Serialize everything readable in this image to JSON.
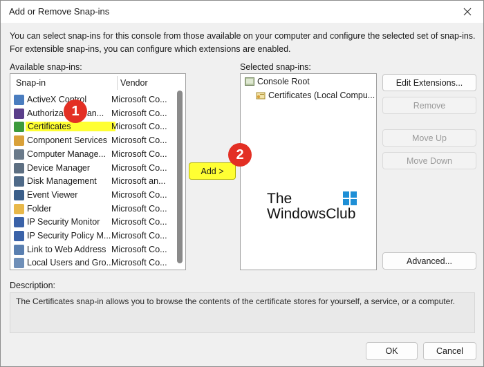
{
  "window": {
    "title": "Add or Remove Snap-ins"
  },
  "intro": {
    "line1": "You can select snap-ins for this console from those available on your computer and configure the selected set of snap-ins.",
    "line2": "For extensible snap-ins, you can configure which extensions are enabled."
  },
  "available": {
    "label": "Available snap-ins:",
    "col_snapin": "Snap-in",
    "col_vendor": "Vendor",
    "items": [
      {
        "name": "ActiveX Control",
        "vendor": "Microsoft Co...",
        "icon": "activex-icon",
        "color": "#4a7dbf"
      },
      {
        "name": "Authorization Man...",
        "vendor": "Microsoft Co...",
        "icon": "authorization-icon",
        "color": "#5a3e8a"
      },
      {
        "name": "Certificates",
        "vendor": "Microsoft Co...",
        "icon": "certificate-icon",
        "color": "#3c9a3c"
      },
      {
        "name": "Component Services",
        "vendor": "Microsoft Co...",
        "icon": "component-services-icon",
        "color": "#d9a13a"
      },
      {
        "name": "Computer Manage...",
        "vendor": "Microsoft Co...",
        "icon": "computer-management-icon",
        "color": "#6a7a8a"
      },
      {
        "name": "Device Manager",
        "vendor": "Microsoft Co...",
        "icon": "device-manager-icon",
        "color": "#5d6f82"
      },
      {
        "name": "Disk Management",
        "vendor": "Microsoft an...",
        "icon": "disk-management-icon",
        "color": "#4f6a88"
      },
      {
        "name": "Event Viewer",
        "vendor": "Microsoft Co...",
        "icon": "event-viewer-icon",
        "color": "#3b5f8a"
      },
      {
        "name": "Folder",
        "vendor": "Microsoft Co...",
        "icon": "folder-icon",
        "color": "#e8b84a"
      },
      {
        "name": "IP Security Monitor",
        "vendor": "Microsoft Co...",
        "icon": "ip-security-monitor-icon",
        "color": "#3a62a8"
      },
      {
        "name": "IP Security Policy M...",
        "vendor": "Microsoft Co...",
        "icon": "ip-security-policy-icon",
        "color": "#3a62a8"
      },
      {
        "name": "Link to Web Address",
        "vendor": "Microsoft Co...",
        "icon": "web-link-icon",
        "color": "#5a7fb0"
      },
      {
        "name": "Local Users and Gro...",
        "vendor": "Microsoft Co...",
        "icon": "local-users-icon",
        "color": "#6f8fb8"
      }
    ]
  },
  "actions": {
    "add": "Add >"
  },
  "selected": {
    "label": "Selected snap-ins:",
    "root": "Console Root",
    "child": "Certificates (Local Compu..."
  },
  "side_buttons": {
    "edit_extensions": "Edit Extensions...",
    "remove": "Remove",
    "move_up": "Move Up",
    "move_down": "Move Down",
    "advanced": "Advanced..."
  },
  "watermark": {
    "line1": "The",
    "line2": "WindowsClub"
  },
  "description": {
    "label": "Description:",
    "text": "The Certificates snap-in allows you to browse the contents of the certificate stores for yourself, a service, or a computer."
  },
  "footer": {
    "ok": "OK",
    "cancel": "Cancel"
  },
  "annotations": {
    "badge1": "1",
    "badge2": "2"
  },
  "colors": {
    "highlight": "#ffff33",
    "badge": "#e32f24"
  }
}
